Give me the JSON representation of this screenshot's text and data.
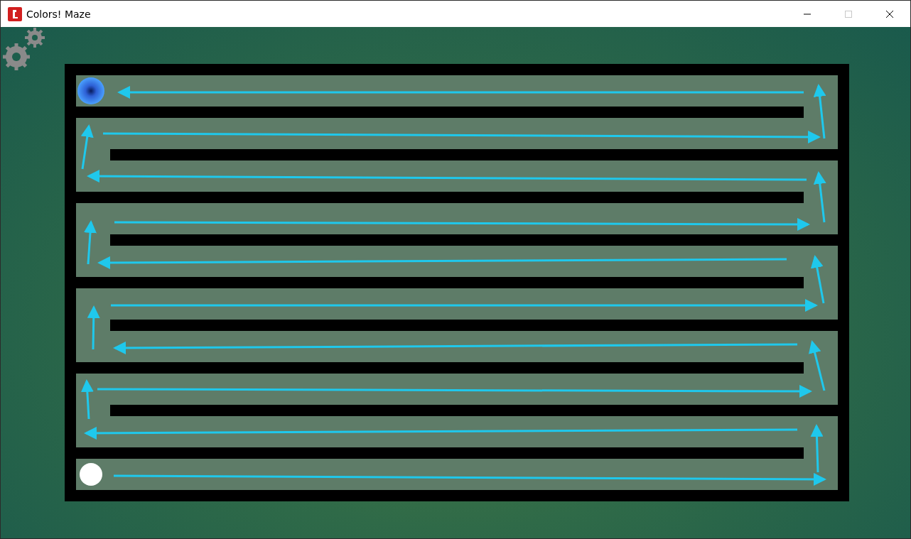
{
  "window": {
    "title": "Colors! Maze",
    "controls": [
      {
        "kind": "minimize",
        "disabled": false
      },
      {
        "kind": "maximize",
        "disabled": true
      },
      {
        "kind": "close",
        "disabled": false
      }
    ]
  }
}
